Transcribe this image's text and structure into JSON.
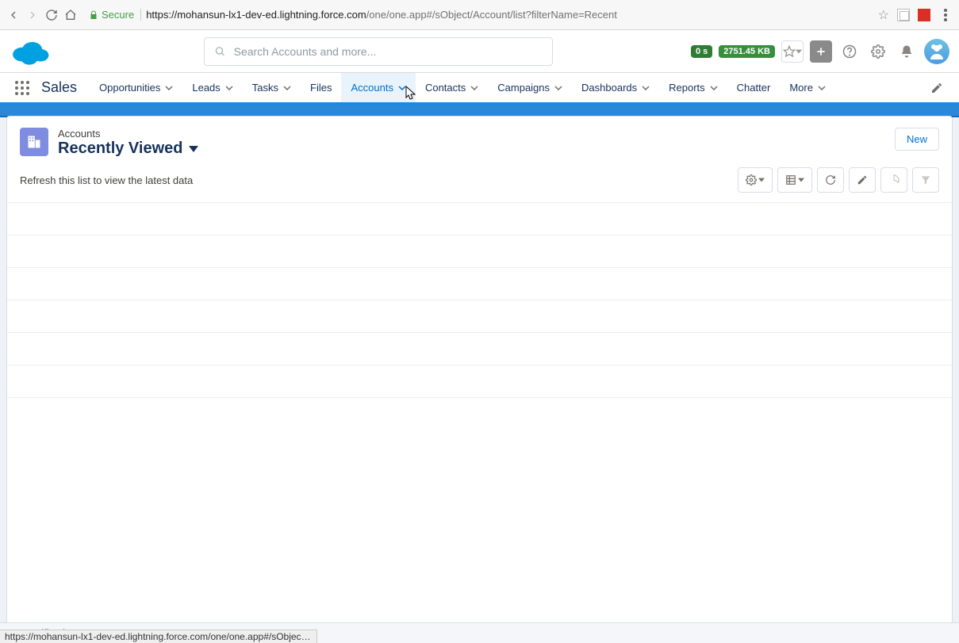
{
  "browser": {
    "secure_label": "Secure",
    "url_domain": "https://mohansun-lx1-dev-ed.lightning.force.com",
    "url_path": "/one/one.app#/sObject/Account/list?filterName=Recent"
  },
  "perf": {
    "time": "0 s",
    "mem": "2751.45 KB"
  },
  "search": {
    "placeholder": "Search Accounts and more..."
  },
  "app": {
    "name": "Sales"
  },
  "nav": {
    "items": [
      {
        "label": "Opportunities",
        "dropdown": true,
        "active": false
      },
      {
        "label": "Leads",
        "dropdown": true,
        "active": false
      },
      {
        "label": "Tasks",
        "dropdown": true,
        "active": false
      },
      {
        "label": "Files",
        "dropdown": false,
        "active": false
      },
      {
        "label": "Accounts",
        "dropdown": true,
        "active": true
      },
      {
        "label": "Contacts",
        "dropdown": true,
        "active": false
      },
      {
        "label": "Campaigns",
        "dropdown": true,
        "active": false
      },
      {
        "label": "Dashboards",
        "dropdown": true,
        "active": false
      },
      {
        "label": "Reports",
        "dropdown": true,
        "active": false
      },
      {
        "label": "Chatter",
        "dropdown": false,
        "active": false
      },
      {
        "label": "More",
        "dropdown": true,
        "active": false
      }
    ]
  },
  "page": {
    "object_label": "Accounts",
    "view_name": "Recently Viewed",
    "action_new": "New",
    "refresh_hint": "Refresh this list to view the latest data"
  },
  "utility": {
    "notifications": "Notifications"
  },
  "status_bar_href": "https://mohansun-lx1-dev-ed.lightning.force.com/one/one.app#/sObject/A..."
}
